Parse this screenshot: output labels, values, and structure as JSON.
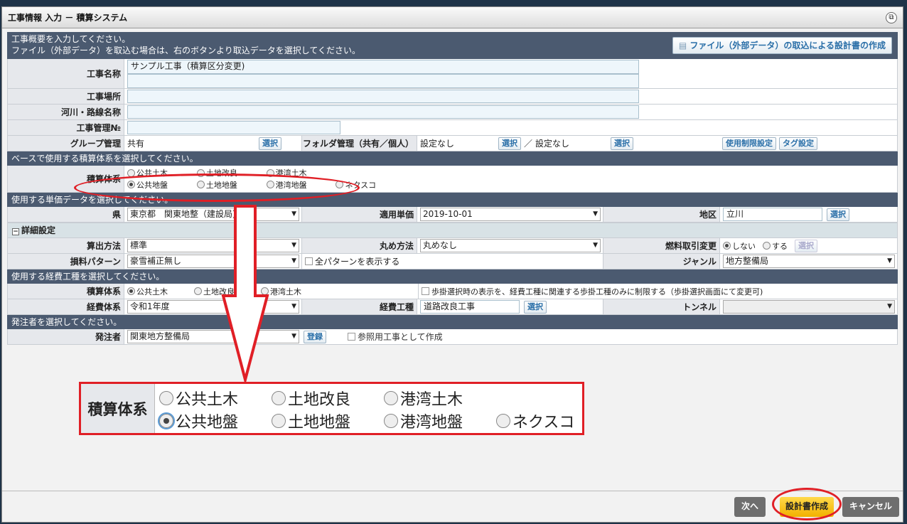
{
  "window": {
    "title": "工事情報 入力 － 積算システム"
  },
  "intro": {
    "line1": "工事概要を入力してください。",
    "line2": "ファイル（外部データ）を取込む場合は、右のボタンより取込データを選択してください。",
    "import_button": "ファイル（外部データ）の取込による設計書の作成"
  },
  "fields": {
    "name_label": "工事名称",
    "name_value": "サンプル工事（積算区分変更)",
    "place_label": "工事場所",
    "river_label": "河川・路線名称",
    "mgmt_label": "工事管理№",
    "group_label": "グループ管理",
    "group_value": "共有",
    "select": "選択",
    "folder_label": "フォルダ管理（共有／個人）",
    "folder_value1": "設定なし",
    "slash": "／",
    "folder_value2": "設定なし",
    "restrict_button": "使用制限設定",
    "tag_button": "タグ設定"
  },
  "base": {
    "section": "ベースで使用する積算体系を選択してください。",
    "label": "積算体系",
    "options_row1": [
      "公共土木",
      "土地改良",
      "港湾土木"
    ],
    "options_row2": [
      "公共地盤",
      "土地地盤",
      "港湾地盤",
      "ネクスコ"
    ]
  },
  "unit": {
    "section": "使用する単価データを選択してください。",
    "pref_label": "県",
    "pref_value": "東京都　関東地整（建設局)",
    "apply_label": "適用単価",
    "apply_value": "2019-10-01",
    "area_label": "地区",
    "area_value": "立川"
  },
  "detail": {
    "title": "詳細設定",
    "calc_label": "算出方法",
    "calc_value": "標準",
    "round_label": "丸め方法",
    "round_value": "丸めなし",
    "fuel_label": "燃料取引変更",
    "fuel_no": "しない",
    "fuel_yes": "する",
    "loss_label": "損料パターン",
    "loss_value": "豪雪補正無し",
    "show_all": "全パターンを表示する",
    "genre_label": "ジャンル",
    "genre_value": "地方整備局"
  },
  "expense": {
    "section": "使用する経費工種を選択してください。",
    "system_label": "積算体系",
    "system_opts": [
      "公共土木",
      "土地改良",
      "港湾土木"
    ],
    "limit_text": "歩掛選択時の表示を、経費工種に関連する歩掛工種のみに制限する（歩掛選択画面にて変更可)",
    "exp_label": "経費体系",
    "exp_value": "令和1年度",
    "kind_label": "経費工種",
    "kind_value": "道路改良工事",
    "tunnel_label": "トンネル"
  },
  "orderer": {
    "section": "発注者を選択してください。",
    "label": "発注者",
    "value": "関東地方整備局",
    "register": "登録",
    "ref_text": "参照用工事として作成"
  },
  "zoom": {
    "label": "積算体系",
    "row1": [
      "公共土木",
      "土地改良",
      "港湾土木"
    ],
    "row2": [
      "公共地盤",
      "土地地盤",
      "港湾地盤",
      "ネクスコ"
    ]
  },
  "footer": {
    "next": "次へ",
    "create": "設計書作成",
    "cancel": "キャンセル"
  },
  "colors": {
    "highlight": "#e01f26",
    "section": "#4b5a70",
    "create_btn": "#f5b800"
  }
}
